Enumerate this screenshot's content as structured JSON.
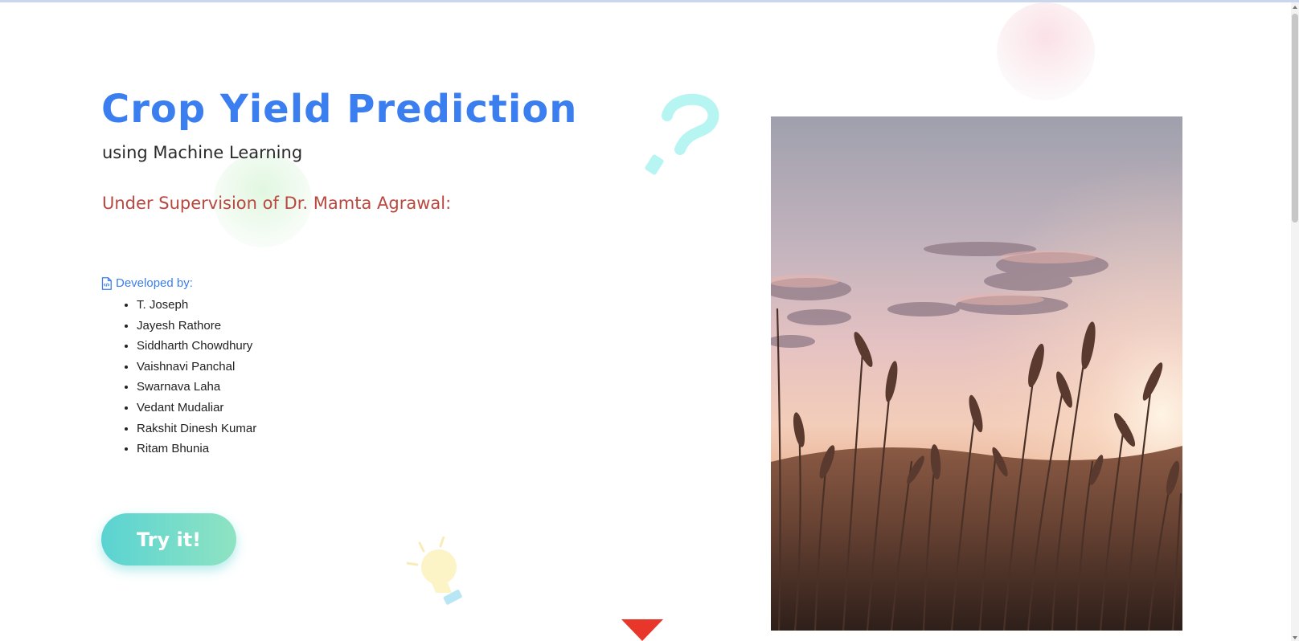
{
  "hero": {
    "title": "Crop Yield Prediction",
    "subtitle": "using Machine Learning",
    "supervision": "Under Supervision of Dr. Mamta Agrawal:"
  },
  "developers": {
    "heading": "Developed by:",
    "icon": "file-code-icon",
    "names": [
      "T. Joseph",
      "Jayesh Rathore",
      "Siddharth Chowdhury",
      "Vaishnavi Panchal",
      "Swarnava Laha",
      "Vedant Mudaliar",
      "Rakshit Dinesh Kumar",
      "Ritam Bhunia"
    ]
  },
  "cta": {
    "label": "Try it!"
  },
  "colors": {
    "accent": "#3b7ef0",
    "supervision_text": "#b8483f",
    "button_start": "#5ad3d2",
    "button_end": "#8fe3c2",
    "scroll_arrow": "#e8372a"
  },
  "decorations": {
    "shapes": [
      "pink-circle",
      "green-circle",
      "question-mark-icon",
      "lightbulb-icon",
      "scroll-down-arrow-icon"
    ],
    "photo": "wheat-field-sunset-photo"
  }
}
